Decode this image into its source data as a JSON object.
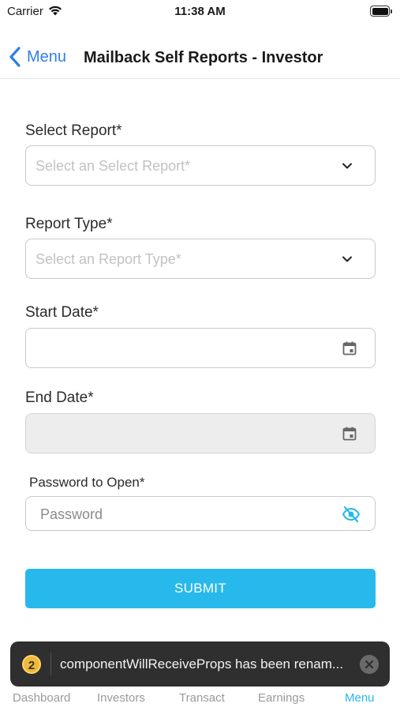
{
  "status_bar": {
    "carrier": "Carrier",
    "time": "11:38 AM"
  },
  "header": {
    "back_label": "Menu",
    "title": "Mailback Self Reports - Investor"
  },
  "form": {
    "select_report": {
      "label": "Select Report*",
      "placeholder": "Select an Select Report*"
    },
    "report_type": {
      "label": "Report Type*",
      "placeholder": "Select an Report Type*"
    },
    "start_date": {
      "label": "Start Date*",
      "value": ""
    },
    "end_date": {
      "label": "End  Date*",
      "value": ""
    },
    "password": {
      "label": "Password to Open*",
      "placeholder": "Password"
    },
    "submit_label": "SUBMIT"
  },
  "toast": {
    "count": "2",
    "message": "componentWillReceiveProps has been renam..."
  },
  "tabs": [
    {
      "label": "Dashboard",
      "active": false
    },
    {
      "label": "Investors",
      "active": false
    },
    {
      "label": "Transact",
      "active": false
    },
    {
      "label": "Earnings",
      "active": false
    },
    {
      "label": "Menu",
      "active": true
    }
  ],
  "colors": {
    "accent": "#27b9ec",
    "link": "#2f7ee6",
    "toast_bg": "#2f2f2f",
    "badge": "#f1b93a"
  },
  "icons": {
    "wifi": "wifi-icon",
    "battery": "battery-icon",
    "back": "chevron-left-icon",
    "dropdown": "chevron-down-icon",
    "calendar": "calendar-icon",
    "visibility": "eye-off-icon",
    "close": "close-icon"
  }
}
